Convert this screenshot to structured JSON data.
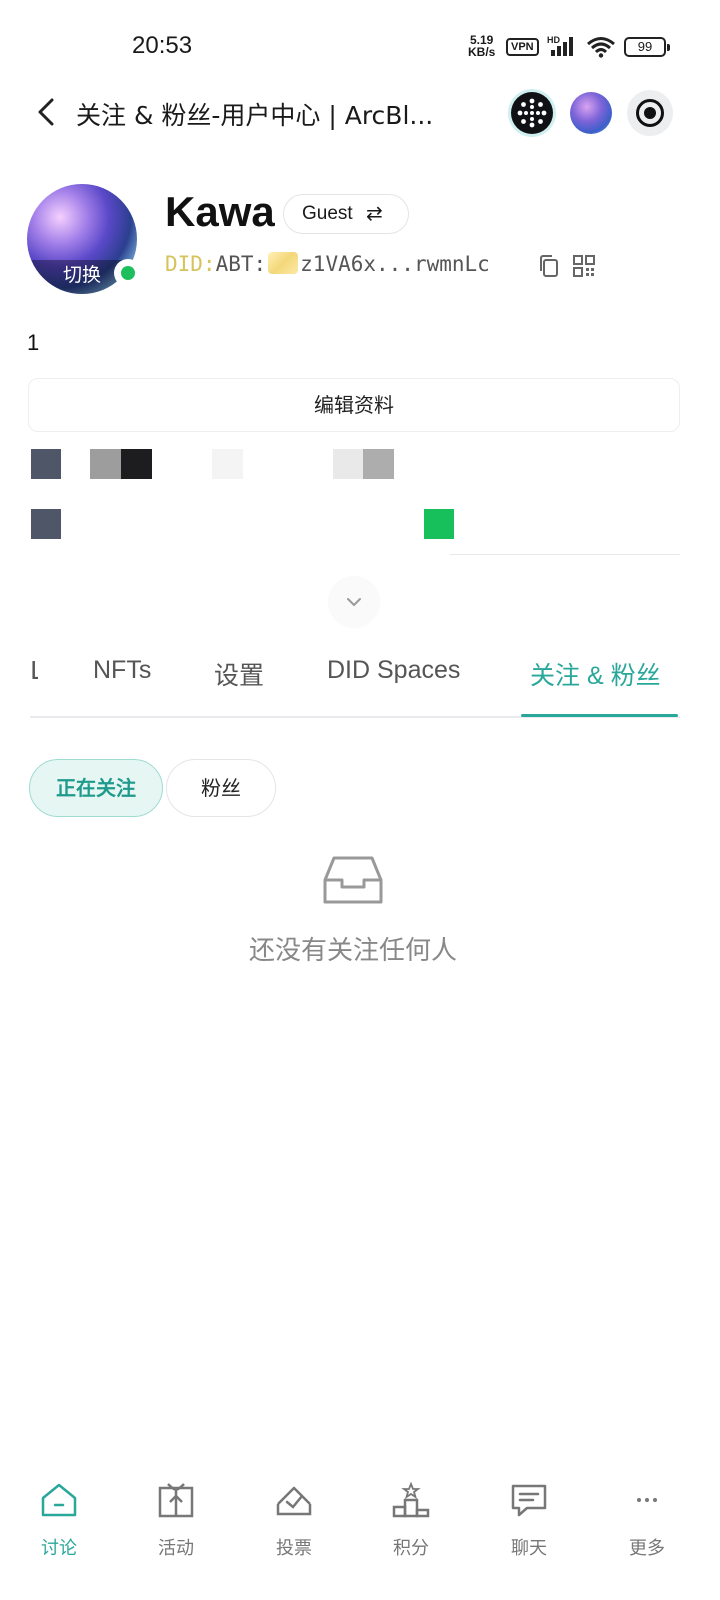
{
  "status_bar": {
    "time": "20:53",
    "net_speed_value": "5.19",
    "net_speed_unit": "KB/s",
    "vpn": "VPN",
    "hd": "HD",
    "battery": "99"
  },
  "header": {
    "title": "关注 & 粉丝-用户中心 | ArcBl..."
  },
  "profile": {
    "avatar_switch_label": "切换",
    "username": "Kawa",
    "role_label": "Guest",
    "role_swap_glyph": "⇄",
    "did_prefix": "DID:",
    "did_chain": "ABT:",
    "did_address": "z1VA6x...rwmnLc",
    "count": "1",
    "edit_label": "编辑资料"
  },
  "tabs": {
    "items": [
      "NFTs",
      "设置",
      "DID Spaces",
      "关注 & 粉丝"
    ],
    "active": "关注 & 粉丝"
  },
  "follow_toggle": {
    "following": "正在关注",
    "fans": "粉丝"
  },
  "empty_state": {
    "message": "还没有关注任何人"
  },
  "bottom_nav": {
    "items": [
      {
        "label": "讨论",
        "icon": "home-icon",
        "active": true
      },
      {
        "label": "活动",
        "icon": "gift-icon",
        "active": false
      },
      {
        "label": "投票",
        "icon": "vote-icon",
        "active": false
      },
      {
        "label": "积分",
        "icon": "podium-icon",
        "active": false
      },
      {
        "label": "聊天",
        "icon": "chat-icon",
        "active": false
      },
      {
        "label": "更多",
        "icon": "more-icon",
        "active": false
      }
    ]
  },
  "colors": {
    "accent": "#2aa79b",
    "online": "#1dbf5c",
    "did_prefix": "#d6c35c"
  }
}
